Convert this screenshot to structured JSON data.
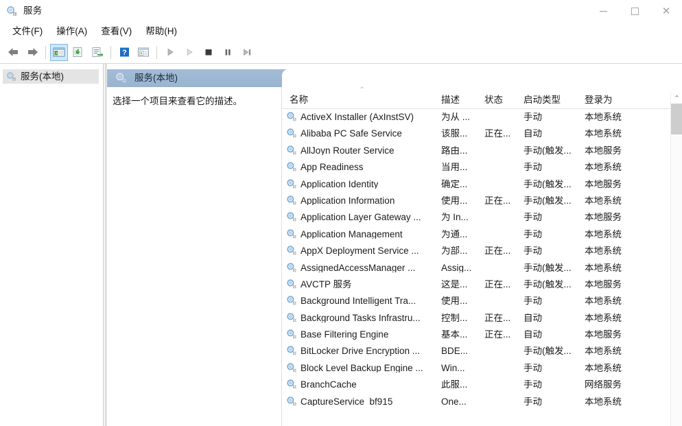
{
  "window": {
    "title": "服务",
    "icon": "services-gear-icon",
    "controls": {
      "minimize": "minimize-icon",
      "maximize": "maximize-icon",
      "close": "close-icon"
    }
  },
  "menubar": {
    "items": [
      {
        "label": "文件(F)",
        "name": "menu-file"
      },
      {
        "label": "操作(A)",
        "name": "menu-action"
      },
      {
        "label": "查看(V)",
        "name": "menu-view"
      },
      {
        "label": "帮助(H)",
        "name": "menu-help"
      }
    ]
  },
  "toolbar": {
    "buttons": [
      {
        "icon": "back-arrow-icon",
        "name": "toolbar-back"
      },
      {
        "icon": "forward-arrow-icon",
        "name": "toolbar-forward"
      },
      {
        "icon": "show-hide-console-tree-icon",
        "name": "toolbar-console-tree",
        "active": true
      },
      {
        "icon": "refresh-icon",
        "name": "toolbar-refresh"
      },
      {
        "icon": "export-list-icon",
        "name": "toolbar-export"
      },
      {
        "icon": "help-icon",
        "name": "toolbar-help"
      },
      {
        "icon": "properties-icon",
        "name": "toolbar-properties"
      },
      {
        "icon": "start-service-icon",
        "name": "toolbar-start"
      },
      {
        "icon": "resume-service-icon",
        "name": "toolbar-resume"
      },
      {
        "icon": "stop-service-icon",
        "name": "toolbar-stop"
      },
      {
        "icon": "pause-service-icon",
        "name": "toolbar-pause"
      },
      {
        "icon": "restart-service-icon",
        "name": "toolbar-restart"
      }
    ]
  },
  "sidebar": {
    "tree_item": {
      "label": "服务(本地)",
      "icon": "services-gear-icon",
      "selected": true
    }
  },
  "main": {
    "panel_title": "服务(本地)",
    "panel_icon": "services-gear-icon",
    "description_placeholder": "选择一个项目来查看它的描述。",
    "sort_caret": "^",
    "columns": [
      {
        "key": "name",
        "label": "名称"
      },
      {
        "key": "description",
        "label": "描述"
      },
      {
        "key": "status",
        "label": "状态"
      },
      {
        "key": "startup",
        "label": "启动类型"
      },
      {
        "key": "logon",
        "label": "登录为"
      }
    ],
    "rows": [
      {
        "icon": "service-gear-icon",
        "name": "ActiveX Installer (AxInstSV)",
        "description": "为从 ...",
        "status": "",
        "startup": "手动",
        "logon": "本地系统"
      },
      {
        "icon": "service-gear-icon",
        "name": "Alibaba PC Safe Service",
        "description": "该服...",
        "status": "正在...",
        "startup": "自动",
        "logon": "本地系统"
      },
      {
        "icon": "service-gear-icon",
        "name": "AllJoyn Router Service",
        "description": "路由...",
        "status": "",
        "startup": "手动(触发...",
        "logon": "本地服务"
      },
      {
        "icon": "service-gear-icon",
        "name": "App Readiness",
        "description": "当用...",
        "status": "",
        "startup": "手动",
        "logon": "本地系统"
      },
      {
        "icon": "service-gear-icon",
        "name": "Application Identity",
        "description": "确定...",
        "status": "",
        "startup": "手动(触发...",
        "logon": "本地服务"
      },
      {
        "icon": "service-gear-icon",
        "name": "Application Information",
        "description": "使用...",
        "status": "正在...",
        "startup": "手动(触发...",
        "logon": "本地系统"
      },
      {
        "icon": "service-gear-icon",
        "name": "Application Layer Gateway ...",
        "description": "为 In...",
        "status": "",
        "startup": "手动",
        "logon": "本地服务"
      },
      {
        "icon": "service-gear-icon",
        "name": "Application Management",
        "description": "为通...",
        "status": "",
        "startup": "手动",
        "logon": "本地系统"
      },
      {
        "icon": "service-gear-icon",
        "name": "AppX Deployment Service ...",
        "description": "为部...",
        "status": "正在...",
        "startup": "手动",
        "logon": "本地系统"
      },
      {
        "icon": "service-gear-icon",
        "name": "AssignedAccessManager ...",
        "description": "Assig...",
        "status": "",
        "startup": "手动(触发...",
        "logon": "本地系统"
      },
      {
        "icon": "service-gear-icon",
        "name": "AVCTP 服务",
        "description": "这是...",
        "status": "正在...",
        "startup": "手动(触发...",
        "logon": "本地服务"
      },
      {
        "icon": "service-gear-icon",
        "name": "Background Intelligent Tra...",
        "description": "使用...",
        "status": "",
        "startup": "手动",
        "logon": "本地系统"
      },
      {
        "icon": "service-gear-icon",
        "name": "Background Tasks Infrastru...",
        "description": "控制...",
        "status": "正在...",
        "startup": "自动",
        "logon": "本地系统"
      },
      {
        "icon": "service-gear-icon",
        "name": "Base Filtering Engine",
        "description": "基本...",
        "status": "正在...",
        "startup": "自动",
        "logon": "本地服务"
      },
      {
        "icon": "service-gear-icon",
        "name": "BitLocker Drive Encryption ...",
        "description": "BDE...",
        "status": "",
        "startup": "手动(触发...",
        "logon": "本地系统"
      },
      {
        "icon": "service-gear-icon",
        "name": "Block Level Backup Engine ...",
        "description": "Win...",
        "status": "",
        "startup": "手动",
        "logon": "本地系统"
      },
      {
        "icon": "service-gear-icon",
        "name": "BranchCache",
        "description": "此服...",
        "status": "",
        "startup": "手动",
        "logon": "网络服务"
      },
      {
        "icon": "service-gear-icon",
        "name": "CaptureService_bf915",
        "description": "One...",
        "status": "",
        "startup": "手动",
        "logon": "本地系统"
      }
    ],
    "scrollbar": {
      "up_arrow": "^"
    }
  },
  "colors": {
    "panel_header": "#9cb8d4",
    "toolbar_active": "#cde8ff",
    "text": "#1b1b1b",
    "service_icon": "#7fb0d8"
  }
}
